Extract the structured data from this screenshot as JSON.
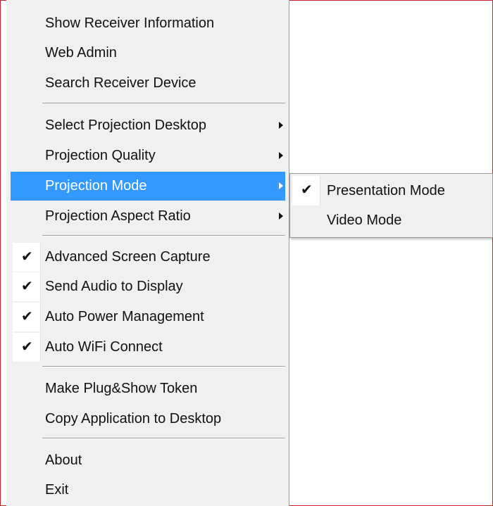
{
  "menu": {
    "group1": [
      {
        "label": "Show Receiver Information"
      },
      {
        "label": "Web Admin"
      },
      {
        "label": "Search Receiver Device"
      }
    ],
    "group2": [
      {
        "label": "Select Projection Desktop",
        "submenu": true
      },
      {
        "label": "Projection Quality",
        "submenu": true
      },
      {
        "label": "Projection Mode",
        "submenu": true,
        "highlighted": true
      },
      {
        "label": "Projection Aspect Ratio",
        "submenu": true
      }
    ],
    "group3": [
      {
        "label": "Advanced Screen Capture",
        "checked": true
      },
      {
        "label": "Send Audio to Display",
        "checked": true
      },
      {
        "label": "Auto Power Management",
        "checked": true
      },
      {
        "label": "Auto WiFi Connect",
        "checked": true
      }
    ],
    "group4": [
      {
        "label": "Make Plug&Show Token"
      },
      {
        "label": "Copy Application to Desktop"
      }
    ],
    "group5": [
      {
        "label": "About"
      },
      {
        "label": "Exit"
      }
    ]
  },
  "submenu": {
    "items": [
      {
        "label": "Presentation Mode",
        "checked": true
      },
      {
        "label": "Video Mode",
        "checked": false
      }
    ]
  },
  "glyphs": {
    "check": "✔"
  },
  "colors": {
    "highlight": "#3399ff",
    "border_accent": "#c8202a",
    "menu_bg": "#f0f0f0"
  }
}
